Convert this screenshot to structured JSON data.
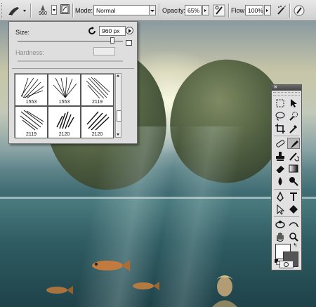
{
  "options_bar": {
    "brush_size_value": "960",
    "mode_label": "Mode:",
    "mode_value": "Normal",
    "opacity_label": "Opacity:",
    "opacity_value": "65%",
    "flow_label": "Flow:",
    "flow_value": "100%",
    "icons": [
      "brush-tool-preset-icon",
      "brush-picker-icon",
      "brush-panel-toggle-icon",
      "pressure-opacity-icon",
      "airbrush-icon",
      "pressure-size-icon"
    ]
  },
  "brush_panel": {
    "size_label": "Size:",
    "size_value": "960 px",
    "size_level": 0.9,
    "hardness_label": "Hardness:",
    "presets": [
      {
        "label": "1553"
      },
      {
        "label": "1553"
      },
      {
        "label": "2119"
      },
      {
        "label": "2119"
      },
      {
        "label": "2120"
      },
      {
        "label": "2120"
      }
    ]
  },
  "tools_panel": {
    "collapse_glyph": "»",
    "close_glyph": "×",
    "tools": [
      "marquee-tool-icon",
      "move-tool-icon",
      "lasso-tool-icon",
      "quick-select-tool-icon",
      "crop-tool-icon",
      "eyedropper-tool-icon",
      "spot-healing-tool-icon",
      "brush-tool-icon",
      "clone-stamp-tool-icon",
      "history-brush-tool-icon",
      "eraser-tool-icon",
      "gradient-tool-icon",
      "blur-tool-icon",
      "dodge-tool-icon",
      "pen-tool-icon",
      "type-tool-icon",
      "path-select-tool-icon",
      "shape-tool-icon",
      "3d-rotate-tool-icon",
      "3d-orbit-tool-icon",
      "hand-tool-icon",
      "zoom-tool-icon"
    ],
    "active_tool": "brush-tool-icon",
    "foreground_color": "#ffffff",
    "background_color": "#555555"
  }
}
